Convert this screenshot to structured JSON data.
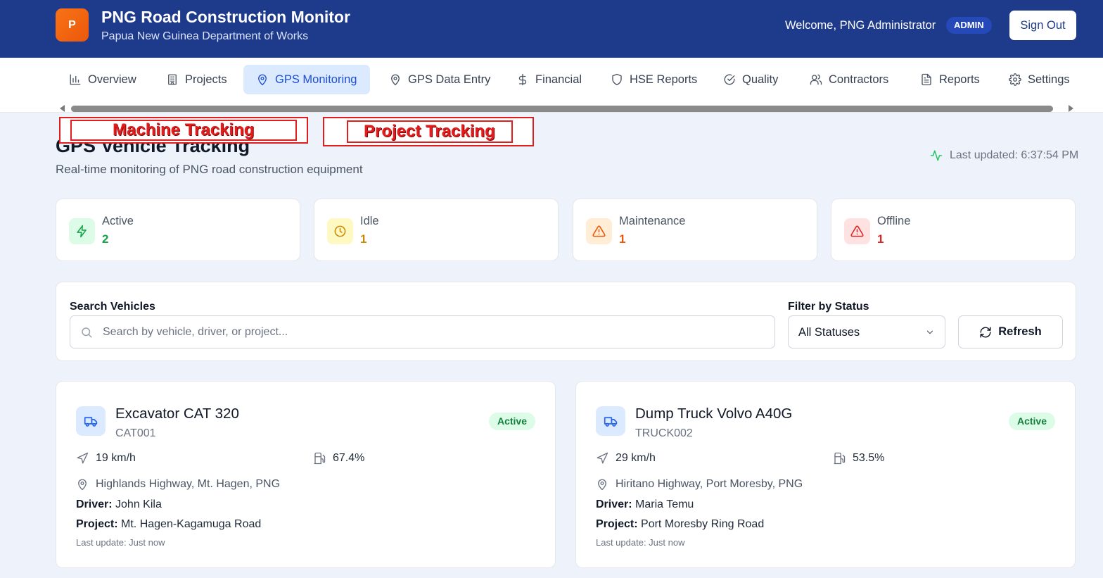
{
  "header": {
    "logo_letter": "P",
    "title": "PNG Road Construction Monitor",
    "subtitle": "Papua New Guinea Department of Works",
    "welcome": "Welcome, PNG Administrator",
    "role": "ADMIN",
    "sign_out": "Sign Out"
  },
  "nav": {
    "items": [
      {
        "label": "Overview",
        "icon": "bar-chart-icon"
      },
      {
        "label": "Projects",
        "icon": "building-icon"
      },
      {
        "label": "GPS Monitoring",
        "icon": "map-pin-icon",
        "active": true
      },
      {
        "label": "GPS Data Entry",
        "icon": "map-pin-icon"
      },
      {
        "label": "Financial",
        "icon": "dollar-icon"
      },
      {
        "label": "HSE Reports",
        "icon": "shield-icon"
      },
      {
        "label": "Quality",
        "icon": "check-circle-icon"
      },
      {
        "label": "Contractors",
        "icon": "users-icon"
      },
      {
        "label": "Reports",
        "icon": "file-text-icon"
      },
      {
        "label": "Settings",
        "icon": "gear-icon"
      }
    ]
  },
  "annotations": {
    "machine": "Machine Tracking",
    "project": "Project Tracking"
  },
  "page": {
    "title": "GPS Vehicle Tracking",
    "subtitle": "Real-time monitoring of PNG road construction equipment",
    "last_updated": "Last updated: 6:37:54 PM"
  },
  "stats": [
    {
      "label": "Active",
      "value": "2",
      "icon": "zap-icon",
      "color": "#16a34a",
      "bg": "#dcfce7"
    },
    {
      "label": "Idle",
      "value": "1",
      "icon": "clock-icon",
      "color": "#ca8a04",
      "bg": "#fef9c3"
    },
    {
      "label": "Maintenance",
      "value": "1",
      "icon": "warning-icon",
      "color": "#ea580c",
      "bg": "#ffedd5"
    },
    {
      "label": "Offline",
      "value": "1",
      "icon": "warning-icon",
      "color": "#dc2626",
      "bg": "#fee2e2"
    }
  ],
  "search": {
    "label": "Search Vehicles",
    "placeholder": "Search by vehicle, driver, or project...",
    "value": ""
  },
  "filter": {
    "label": "Filter by Status",
    "selected": "All Statuses"
  },
  "refresh_label": "Refresh",
  "vehicles": [
    {
      "name": "Excavator CAT 320",
      "id": "CAT001",
      "status": "Active",
      "speed": "19 km/h",
      "fuel": "67.4%",
      "location": "Highlands Highway, Mt. Hagen, PNG",
      "driver_label": "Driver:",
      "driver": "John Kila",
      "project_label": "Project:",
      "project": "Mt. Hagen-Kagamuga Road",
      "last_update": "Last update: Just now"
    },
    {
      "name": "Dump Truck Volvo A40G",
      "id": "TRUCK002",
      "status": "Active",
      "speed": "29 km/h",
      "fuel": "53.5%",
      "location": "Hiritano Highway, Port Moresby, PNG",
      "driver_label": "Driver:",
      "driver": "Maria Temu",
      "project_label": "Project:",
      "project": "Port Moresby Ring Road",
      "last_update": "Last update: Just now"
    }
  ]
}
